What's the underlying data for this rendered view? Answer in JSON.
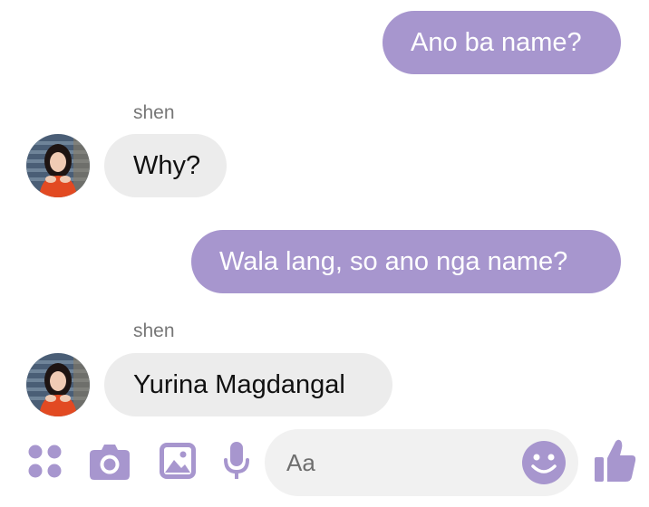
{
  "colors": {
    "accent": "#a796ce",
    "incoming_bubble": "#ececec",
    "input_bg": "#f1f1f1"
  },
  "messages": [
    {
      "direction": "outgoing",
      "text": "Ano ba name?"
    },
    {
      "direction": "incoming",
      "sender": "shen",
      "text": "Why?"
    },
    {
      "direction": "outgoing",
      "text": "Wala lang, so ano nga name?"
    },
    {
      "direction": "incoming",
      "sender": "shen",
      "text": "Yurina Magdangal"
    }
  ],
  "composer": {
    "icons": [
      "apps-icon",
      "camera-icon",
      "gallery-icon",
      "microphone-icon",
      "emoji-icon",
      "thumbs-up-icon"
    ],
    "placeholder": "Aa"
  }
}
